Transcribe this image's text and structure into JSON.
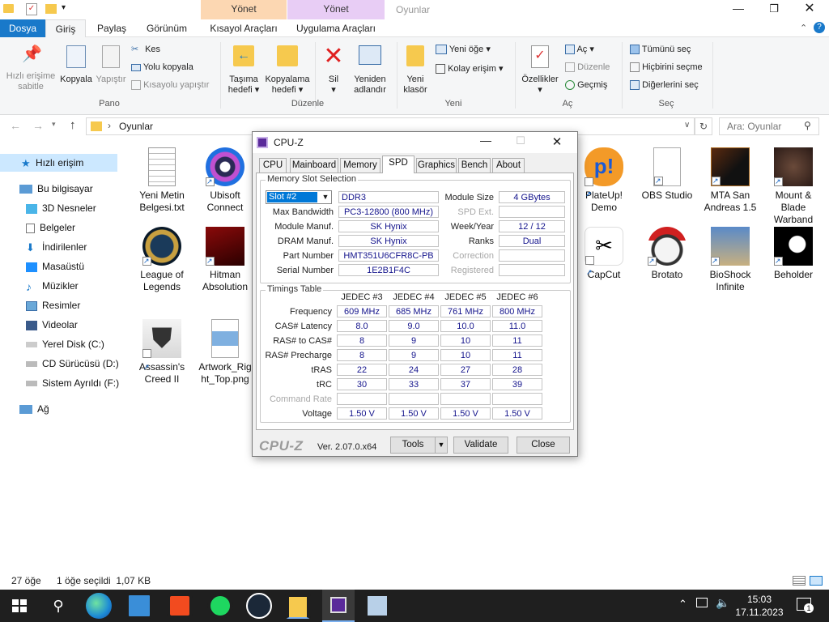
{
  "window": {
    "title": "Oyunlar",
    "context_tab_1": "Yönet",
    "context_tab_2": "Yönet"
  },
  "tabs": {
    "file": "Dosya",
    "home": "Giriş",
    "share": "Paylaş",
    "view": "Görünüm",
    "shortcut_tools": "Kısayol Araçları",
    "app_tools": "Uygulama Araçları"
  },
  "ribbon": {
    "pin": [
      "Hızlı erişime",
      "sabitle"
    ],
    "copy": "Kopyala",
    "paste": "Yapıştır",
    "cut": "Kes",
    "copy_path": "Yolu kopyala",
    "paste_shortcut": "Kısayolu yapıştır",
    "group_clipboard": "Pano",
    "move_to": [
      "Taşıma",
      "hedefi"
    ],
    "copy_to": [
      "Kopyalama",
      "hedefi"
    ],
    "delete": "Sil",
    "rename": [
      "Yeniden",
      "adlandır"
    ],
    "group_organize": "Düzenle",
    "new_folder": [
      "Yeni",
      "klasör"
    ],
    "new_item": "Yeni öğe",
    "easy_access": "Kolay erişim",
    "group_new": "Yeni",
    "properties": "Özellikler",
    "open": "Aç",
    "edit": "Düzenle",
    "history": "Geçmiş",
    "group_open": "Aç",
    "select_all": "Tümünü seç",
    "select_none": "Hiçbirini seçme",
    "invert_selection": "Diğerlerini seç",
    "group_select": "Seç"
  },
  "address": {
    "path": "Oyunlar",
    "search_placeholder": "Ara: Oyunlar"
  },
  "nav": {
    "quick_access": "Hızlı erişim",
    "this_pc": "Bu bilgisayar",
    "items": [
      "3D Nesneler",
      "Belgeler",
      "İndirilenler",
      "Masaüstü",
      "Müzikler",
      "Resimler",
      "Videolar",
      "Yerel Disk (C:)",
      "CD Sürücüsü (D:)",
      "Sistem Ayrıldı (F:)"
    ],
    "network": "Ağ"
  },
  "files": [
    {
      "name": "Yeni Metin Belgesi.txt"
    },
    {
      "name": "Ubisoft Connect"
    },
    {
      "name": "PlateUp! Demo"
    },
    {
      "name": "OBS Studio"
    },
    {
      "name": "MTA San Andreas 1.5"
    },
    {
      "name": "Mount & Blade Warband"
    },
    {
      "name": "League of Legends"
    },
    {
      "name": "Hitman Absolution"
    },
    {
      "name": "CapCut"
    },
    {
      "name": "Brotato"
    },
    {
      "name": "BioShock Infinite"
    },
    {
      "name": "Beholder"
    },
    {
      "name": "Assassin's Creed II"
    },
    {
      "name": "Artwork_Right_Top.png"
    }
  ],
  "status": {
    "count": "27 öğe",
    "selection": "1 öğe seçildi  1,07 KB"
  },
  "taskbar": {
    "time": "15:03",
    "date": "17.11.2023",
    "notifications": "1"
  },
  "cpuz": {
    "title": "CPU-Z",
    "tabs": [
      "CPU",
      "Mainboard",
      "Memory",
      "SPD",
      "Graphics",
      "Bench",
      "About"
    ],
    "active_tab": "SPD",
    "slot_group": "Memory Slot Selection",
    "slot": "Slot #2",
    "mem_type": "DDR3",
    "module_size_label": "Module Size",
    "module_size": "4 GBytes",
    "max_bw_label": "Max Bandwidth",
    "max_bw": "PC3-12800 (800 MHz)",
    "spd_ext_label": "SPD Ext.",
    "spd_ext": "",
    "manuf_label": "Module Manuf.",
    "manuf": "SK Hynix",
    "week_label": "Week/Year",
    "week": "12 / 12",
    "dram_label": "DRAM Manuf.",
    "dram": "SK Hynix",
    "ranks_label": "Ranks",
    "ranks": "Dual",
    "part_label": "Part Number",
    "part": "HMT351U6CFR8C-PB",
    "correction_label": "Correction",
    "correction": "",
    "serial_label": "Serial Number",
    "serial": "1E2B1F4C",
    "registered_label": "Registered",
    "registered": "",
    "timings_group": "Timings Table",
    "timing_cols": [
      "JEDEC #3",
      "JEDEC #4",
      "JEDEC #5",
      "JEDEC #6"
    ],
    "timing_rows": [
      {
        "label": "Frequency",
        "values": [
          "609 MHz",
          "685 MHz",
          "761 MHz",
          "800 MHz"
        ]
      },
      {
        "label": "CAS# Latency",
        "values": [
          "8.0",
          "9.0",
          "10.0",
          "11.0"
        ]
      },
      {
        "label": "RAS# to CAS#",
        "values": [
          "8",
          "9",
          "10",
          "11"
        ]
      },
      {
        "label": "RAS# Precharge",
        "values": [
          "8",
          "9",
          "10",
          "11"
        ]
      },
      {
        "label": "tRAS",
        "values": [
          "22",
          "24",
          "27",
          "28"
        ]
      },
      {
        "label": "tRC",
        "values": [
          "30",
          "33",
          "37",
          "39"
        ]
      },
      {
        "label": "Command Rate",
        "values": [
          "",
          "",
          "",
          ""
        ]
      },
      {
        "label": "Voltage",
        "values": [
          "1.50 V",
          "1.50 V",
          "1.50 V",
          "1.50 V"
        ]
      }
    ],
    "brand": "CPU-Z",
    "version": "Ver. 2.07.0.x64",
    "tools": "Tools",
    "validate": "Validate",
    "close": "Close"
  }
}
